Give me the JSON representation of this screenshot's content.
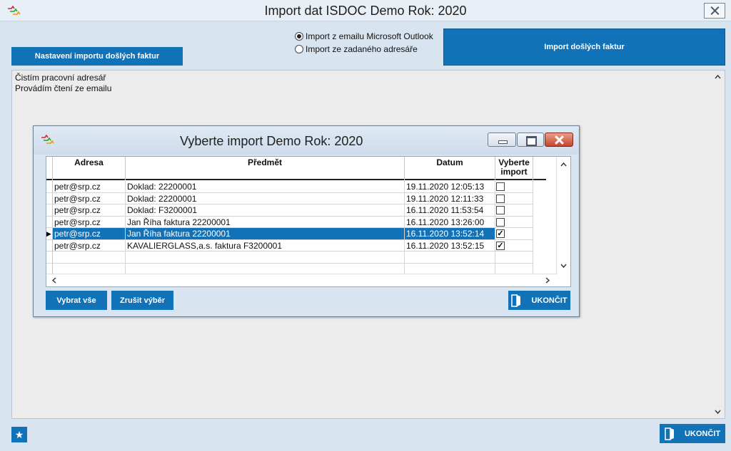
{
  "window": {
    "title": "Import dat  ISDOC  Demo  Rok: 2020"
  },
  "toolbar": {
    "settings_label": "Nastavení importu došlých faktur",
    "import_label": "Import došlých faktur",
    "radio_outlook": "Import z emailu Microsoft Outlook",
    "radio_folder": "Import ze zadaného adresáře",
    "radio_selected": "outlook"
  },
  "log": {
    "lines": [
      "Čistím pracovní adresář",
      "Provádím čtení ze emailu"
    ]
  },
  "footer": {
    "exit_label": "UKONČIT"
  },
  "dialog": {
    "title": "Vyberte import  Demo  Rok: 2020",
    "columns": {
      "address": "Adresa",
      "subject": "Předmět",
      "date": "Datum",
      "select": "Vyberte import"
    },
    "rows": [
      {
        "address": "petr@srp.cz",
        "subject": "Doklad: 22200001",
        "date": "19.11.2020 12:05:13",
        "selected": false
      },
      {
        "address": "petr@srp.cz",
        "subject": "Doklad: 22200001",
        "date": "19.11.2020 12:11:33",
        "selected": false
      },
      {
        "address": "petr@srp.cz",
        "subject": "Doklad: F3200001",
        "date": "16.11.2020 11:53:54",
        "selected": false
      },
      {
        "address": "petr@srp.cz",
        "subject": "Jan Říha faktura 22200001",
        "date": "16.11.2020 13:26:00",
        "selected": false
      },
      {
        "address": "petr@srp.cz",
        "subject": "Jan Říha faktura 22200001",
        "date": "16.11.2020 13:52:14",
        "selected": true
      },
      {
        "address": "petr@srp.cz",
        "subject": "KAVALIERGLASS,a.s. faktura F3200001",
        "date": "16.11.2020 13:52:15",
        "selected": true
      }
    ],
    "current_row": 4,
    "select_all_label": "Vybrat vše",
    "deselect_label": "Zrušit výběr",
    "exit_label": "UKONČIT"
  },
  "colors": {
    "accent": "#1272b8",
    "background": "#d8e4ef"
  }
}
